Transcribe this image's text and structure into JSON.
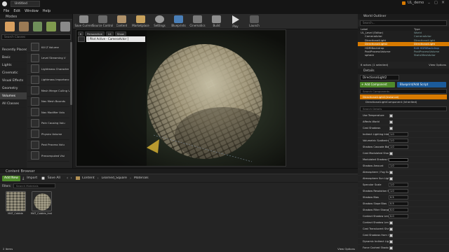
{
  "window": {
    "tab_title": "Untitled",
    "project_name": "UL_demo",
    "menu": [
      "File",
      "Edit",
      "Window",
      "Help"
    ]
  },
  "modes_panel": {
    "title": "Modes",
    "search_placeholder": "Search Classes",
    "categories": [
      "Recently Placed",
      "Basic",
      "Lights",
      "Cinematic",
      "Visual Effects",
      "Geometry",
      "Volumes",
      "All Classes"
    ],
    "selected_category": "Volumes",
    "volumes": [
      "Kill Z Volume",
      "Level Streaming V",
      "Lightmass Character",
      "Lightmass Importance",
      "Mesh Merge Culling V",
      "Nav Mesh Bounds",
      "Nav Modifier Volu",
      "Pain Causing Volu",
      "Physics Volume",
      "Post Process Volu",
      "Precomputed Visi"
    ]
  },
  "toolbar": {
    "buttons": [
      "Save Current",
      "Source Control",
      "Content",
      "Marketplace",
      "Settings",
      "Blueprints",
      "Cinematics",
      "Build",
      "Play",
      "Launch"
    ]
  },
  "viewport": {
    "buttons": [
      "Perspective",
      "Lit",
      "Show"
    ],
    "pilot_label": "[ Pilot Active - CameraActor ]"
  },
  "world_outliner": {
    "title": "World Outliner",
    "search_placeholder": "Search...",
    "col_label": "Label",
    "col_type": "Type",
    "rows": [
      {
        "label": "UL_Level (Editor)",
        "type": "World",
        "selected": false
      },
      {
        "label": "CameraActor",
        "type": "CameraActor",
        "selected": false
      },
      {
        "label": "DirectionalLight",
        "type": "DirectionalLight",
        "selected": false
      },
      {
        "label": "DirectionalLight2",
        "type": "DirectionalLight",
        "selected": true
      },
      {
        "label": "HDRIBackdrop",
        "type": "Edit HDRIBackdrop",
        "selected": false
      },
      {
        "label": "PostProcessVolume",
        "type": "PostProcessVolume",
        "selected": false
      },
      {
        "label": "sphere",
        "type": "StaticMeshActor",
        "selected": false
      }
    ],
    "footer": "6 actors (1 selected)",
    "view_options": "View Options"
  },
  "details": {
    "title": "Details",
    "actor_name": "DirectionalLight2",
    "add_component": "+ Add Component",
    "blueprint_btn": "Blueprint/Add Script",
    "search_placeholder": "Search Components",
    "component_root": "DirectionalLight2(Instance)",
    "component_child": "DirectionalLightComponent (Inherited)",
    "search_details_placeholder": "Search Details",
    "properties": [
      {
        "label": "Use Temperature",
        "type": "check",
        "value": ""
      },
      {
        "label": "Affects World",
        "type": "check",
        "value": ""
      },
      {
        "label": "Cast Shadows",
        "type": "check",
        "value": ""
      },
      {
        "label": "Indirect Lighting Inte",
        "type": "num",
        "value": "1.0"
      },
      {
        "label": "Volumetric Scattering",
        "type": "num",
        "value": "1.0"
      },
      {
        "label": "Shadow Cascade Bias",
        "type": "num",
        "value": "1.0"
      },
      {
        "label": "Cast Modulated Shad",
        "type": "check",
        "value": ""
      },
      {
        "label": "Modulated Shadow C",
        "type": "color",
        "value": ""
      },
      {
        "label": "Shadow Amount",
        "type": "num",
        "value": "1.0"
      },
      {
        "label": "Atmosphere / Fog Su",
        "type": "check",
        "value": ""
      },
      {
        "label": "Atmosphere Sun Ligh",
        "type": "check",
        "value": ""
      },
      {
        "label": "Specular Scale",
        "type": "num",
        "value": "1.0"
      },
      {
        "label": "Shadow Resolution S",
        "type": "num",
        "value": "1.0"
      },
      {
        "label": "Shadow Bias",
        "type": "num",
        "value": "0.5"
      },
      {
        "label": "Shadow Slope Bias",
        "type": "num",
        "value": "0.5"
      },
      {
        "label": "Shadow Filter Sharpe",
        "type": "num",
        "value": "0.0"
      },
      {
        "label": "Contact Shadow Leng",
        "type": "num",
        "value": "0.0"
      },
      {
        "label": "Contact Shadow Leng",
        "type": "check",
        "value": ""
      },
      {
        "label": "Cast Translucent Sha",
        "type": "check",
        "value": ""
      },
      {
        "label": "Cast Shadows from C",
        "type": "check",
        "value": ""
      },
      {
        "label": "Dynamic Indirect Ligh",
        "type": "check",
        "value": ""
      },
      {
        "label": "Force Cached Shadow",
        "type": "check",
        "value": ""
      }
    ]
  },
  "content_browser": {
    "title": "Content Browser",
    "add_new": "Add New",
    "import": "Import",
    "save_all": "Save All",
    "breadcrumb": [
      "Content",
      "Learned_Square",
      "Materials"
    ],
    "filters": "Filters",
    "search_placeholder": "Search Materials",
    "assets": [
      {
        "name": "MAT_Cobble"
      },
      {
        "name": "MAT_Cobble_Inst"
      }
    ],
    "footer": "2 items",
    "view_options": "View Options"
  },
  "colors": {
    "accent_orange": "#d87a00",
    "add_green": "#4f8a2b",
    "blueprint_blue": "#1b5b9b"
  }
}
